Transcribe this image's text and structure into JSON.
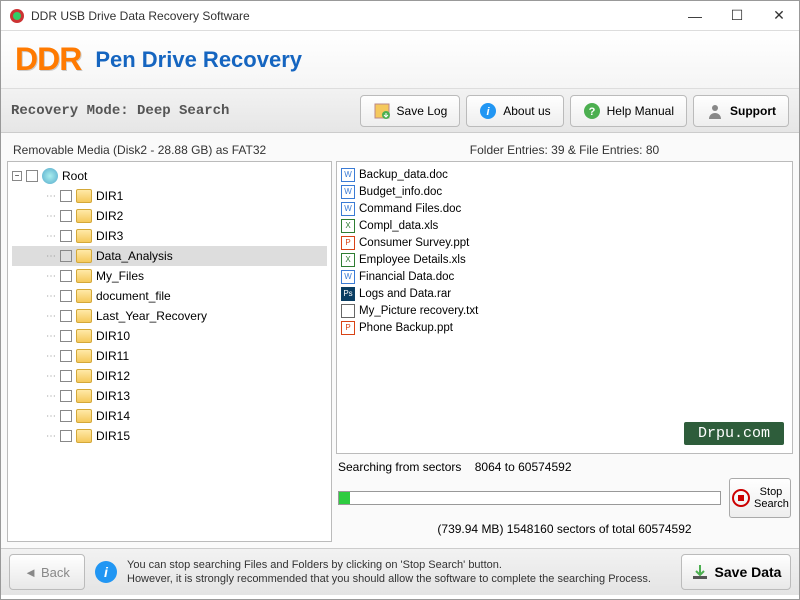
{
  "titlebar": {
    "text": "DDR USB Drive Data Recovery Software"
  },
  "header": {
    "logo": "DDR",
    "app_name": "Pen Drive Recovery"
  },
  "toolbar": {
    "mode": "Recovery Mode: Deep Search",
    "save_log": "Save Log",
    "about": "About us",
    "help": "Help Manual",
    "support": "Support"
  },
  "left": {
    "media": "Removable Media (Disk2 - 28.88 GB) as FAT32",
    "root": "Root",
    "items": [
      "DIR1",
      "DIR2",
      "DIR3",
      "Data_Analysis",
      "My_Files",
      "document_file",
      "Last_Year_Recovery",
      "DIR10",
      "DIR11",
      "DIR12",
      "DIR13",
      "DIR14",
      "DIR15"
    ],
    "selected_index": 3
  },
  "right": {
    "entries": "Folder Entries: 39 & File Entries: 80",
    "files": [
      {
        "name": "Backup_data.doc",
        "type": "doc"
      },
      {
        "name": "Budget_info.doc",
        "type": "doc"
      },
      {
        "name": "Command Files.doc",
        "type": "doc"
      },
      {
        "name": "Compl_data.xls",
        "type": "xls"
      },
      {
        "name": "Consumer Survey.ppt",
        "type": "ppt"
      },
      {
        "name": "Employee Details.xls",
        "type": "xls"
      },
      {
        "name": "Financial Data.doc",
        "type": "doc"
      },
      {
        "name": "Logs and Data.rar",
        "type": "rar"
      },
      {
        "name": "My_Picture recovery.txt",
        "type": "txt"
      },
      {
        "name": "Phone Backup.ppt",
        "type": "ppt"
      }
    ],
    "watermark": "Drpu.com"
  },
  "progress": {
    "sector_label_prefix": "Searching from sectors",
    "sector_range": "8064 to 60574592",
    "stop": "Stop Search",
    "total": "(739.94 MB)  1548160   sectors  of  total  60574592"
  },
  "footer": {
    "back": "Back",
    "info": "You can stop searching Files and Folders by clicking on 'Stop Search' button.\nHowever, it is strongly recommended that you should allow the software to complete the searching Process.",
    "save": "Save Data"
  }
}
